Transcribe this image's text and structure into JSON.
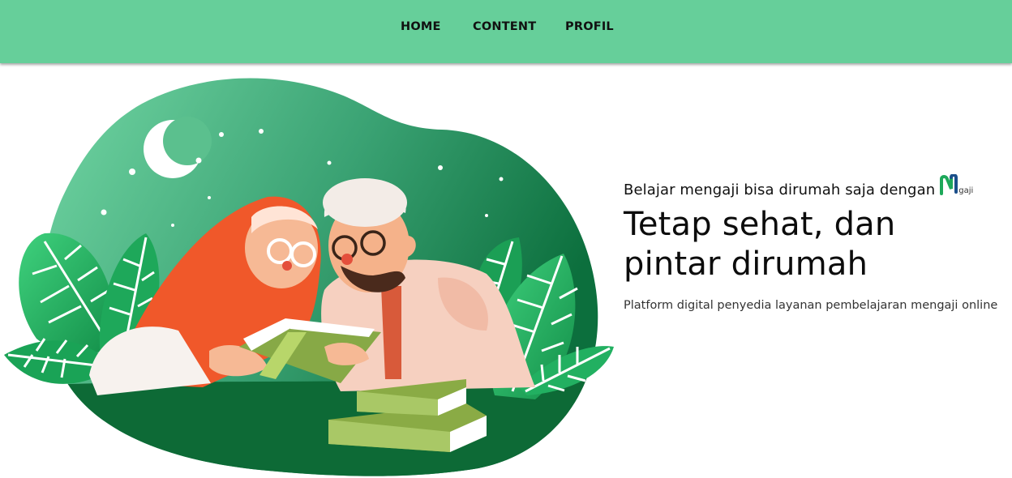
{
  "nav": {
    "items": [
      {
        "label": "HOME"
      },
      {
        "label": "CONTENT"
      },
      {
        "label": "PROFIL"
      }
    ]
  },
  "hero": {
    "tagline": "Belajar mengaji bisa dirumah saja dengan",
    "brand_suffix": "gaji",
    "headline": "Tetap sehat, dan pintar dirumah",
    "description": "Platform digital penyedia layanan pembelajaran mengaji online"
  },
  "colors": {
    "navbar": "#66cf9a",
    "blob_light": "#6fd3a0",
    "blob_dark": "#0f7a44",
    "hijab": "#f0582a",
    "book": "#8aab45",
    "leaf": "#1fae5c"
  },
  "icons": [
    "crescent-moon-icon",
    "ngaji-logo-icon"
  ]
}
